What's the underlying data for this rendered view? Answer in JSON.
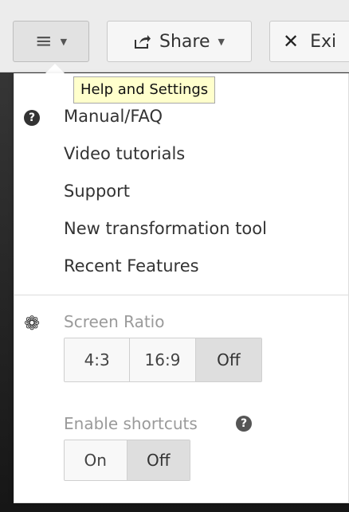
{
  "toolbar": {
    "menu_icon": "hamburger-icon",
    "share_label": "Share",
    "exit_label": "Exi"
  },
  "tooltip": {
    "text": "Help and Settings"
  },
  "menu": {
    "items": [
      {
        "label": "Manual/FAQ"
      },
      {
        "label": "Video tutorials"
      },
      {
        "label": "Support"
      },
      {
        "label": "New transformation tool"
      },
      {
        "label": "Recent Features"
      }
    ]
  },
  "screen_ratio": {
    "label": "Screen Ratio",
    "options": [
      "4:3",
      "16:9",
      "Off"
    ],
    "selected": "Off"
  },
  "shortcuts": {
    "label": "Enable shortcuts",
    "options": [
      "On",
      "Off"
    ],
    "selected": "Off"
  },
  "colors": {
    "tooltip_bg": "#ffffcc",
    "active_option_bg": "#dedede"
  }
}
